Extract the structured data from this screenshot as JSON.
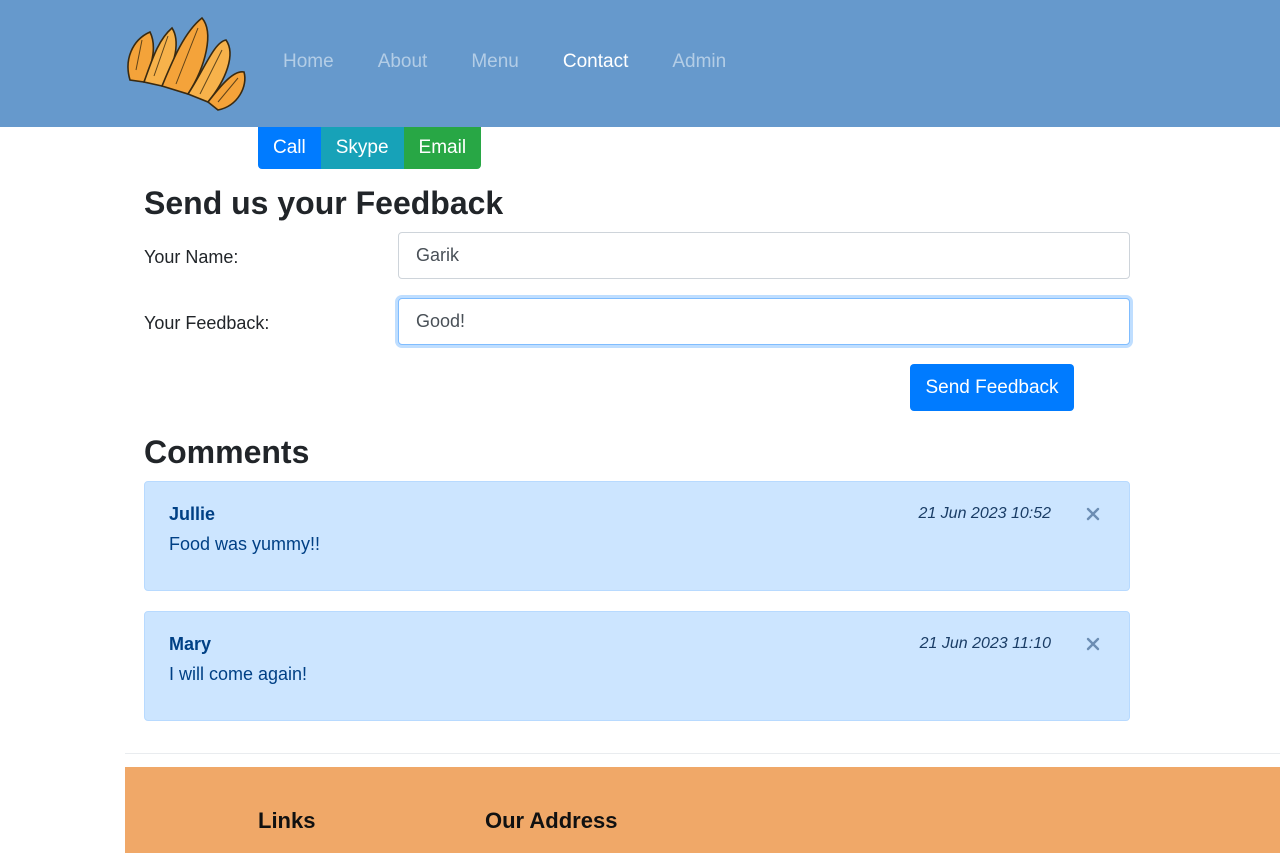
{
  "nav": {
    "logo_name": "croissant-logo",
    "items": [
      {
        "label": "Home",
        "active": false
      },
      {
        "label": "About",
        "active": false
      },
      {
        "label": "Menu",
        "active": false
      },
      {
        "label": "Contact",
        "active": true
      },
      {
        "label": "Admin",
        "active": false
      }
    ]
  },
  "contact_buttons": {
    "call": "Call",
    "skype": "Skype",
    "email": "Email"
  },
  "feedback": {
    "heading": "Send us your Feedback",
    "name_label": "Your Name:",
    "name_value": "Garik",
    "feedback_label": "Your Feedback:",
    "feedback_value": "Good!",
    "send_label": "Send Feedback"
  },
  "comments": {
    "heading": "Comments",
    "items": [
      {
        "author": "Jullie",
        "text": "Food was yummy!!",
        "date": "21 Jun 2023 10:52"
      },
      {
        "author": "Mary",
        "text": "I will come again!",
        "date": "21 Jun 2023 11:10"
      }
    ]
  },
  "footer": {
    "links_heading": "Links",
    "address_heading": "Our Address"
  },
  "colors": {
    "navbar": "#6699cc",
    "primary": "#007bff",
    "info": "#17a2b8",
    "success": "#28a745",
    "alert_bg": "#cce5ff",
    "footer": "#f0a868"
  }
}
